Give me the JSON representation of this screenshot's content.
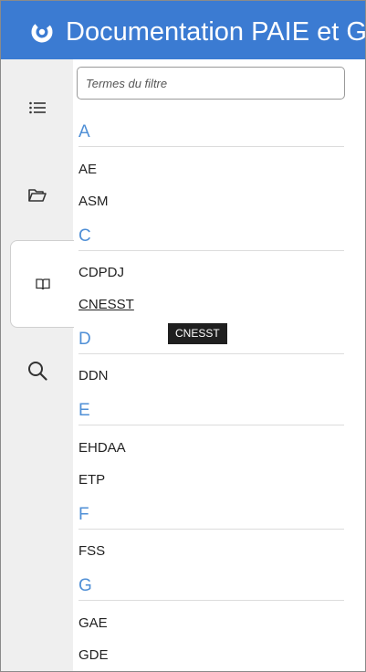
{
  "header": {
    "title": "Documentation PAIE et GRH"
  },
  "sidebar": {
    "items": [
      {
        "name": "list-icon"
      },
      {
        "name": "folder-open-icon"
      },
      {
        "name": "book-open-icon"
      },
      {
        "name": "search-icon"
      }
    ]
  },
  "filter": {
    "placeholder": "Termes du filtre",
    "value": ""
  },
  "glossary": {
    "a": {
      "letter": "A",
      "terms": [
        "AE",
        "ASM"
      ]
    },
    "c": {
      "letter": "C",
      "terms": [
        "CDPDJ",
        "CNESST"
      ]
    },
    "d": {
      "letter": "D",
      "terms": [
        "DDN"
      ]
    },
    "e": {
      "letter": "E",
      "terms": [
        "EHDAA",
        "ETP"
      ]
    },
    "f": {
      "letter": "F",
      "terms": [
        "FSS"
      ]
    },
    "g": {
      "letter": "G",
      "terms": [
        "GAE",
        "GDE"
      ]
    }
  },
  "tooltip": {
    "text": "CNESST"
  },
  "colors": {
    "header": "#3b7bd2",
    "letter": "#4f8fd6",
    "sidebar": "#efefef"
  }
}
